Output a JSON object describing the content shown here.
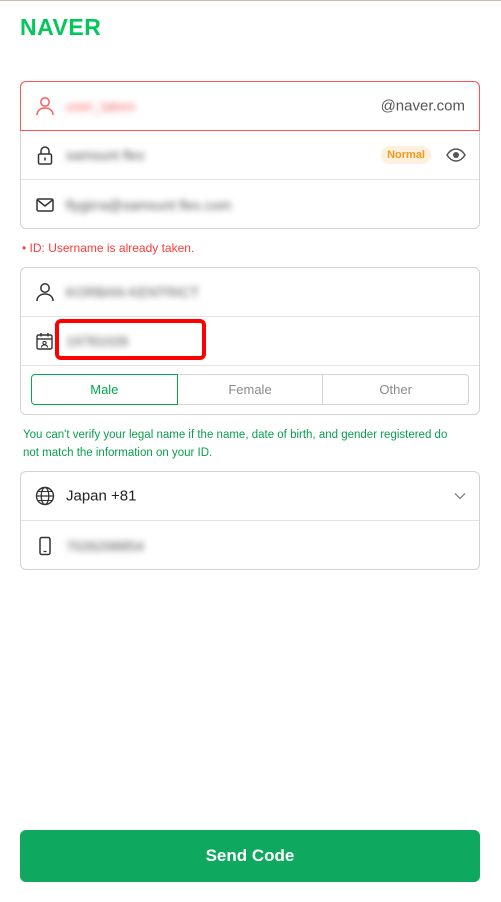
{
  "brand": {
    "logo": "NAVER",
    "color": "#03c75a"
  },
  "id_section": {
    "username_value": "user_taken",
    "domain": "@naver.com",
    "password_value": "samsunt flex",
    "password_strength": "Normal",
    "email_value": "flygirra@samsunt flex.com"
  },
  "error_message": "• ID: Username is already taken.",
  "info_section": {
    "name_value": "KORBAN KENTRICT",
    "birthdate_value": "19781026",
    "gender_options": [
      "Male",
      "Female",
      "Other"
    ],
    "gender_selected": "Male"
  },
  "notice": "You can't verify your legal name if the name, date of birth, and gender registered do not match the information on your ID.",
  "phone_section": {
    "country": "Japan  +81",
    "phone_value": "7026298854"
  },
  "send_button": "Send Code",
  "colors": {
    "accent": "#03a94e",
    "error": "#ff3b3b",
    "button": "#0ea85e"
  }
}
